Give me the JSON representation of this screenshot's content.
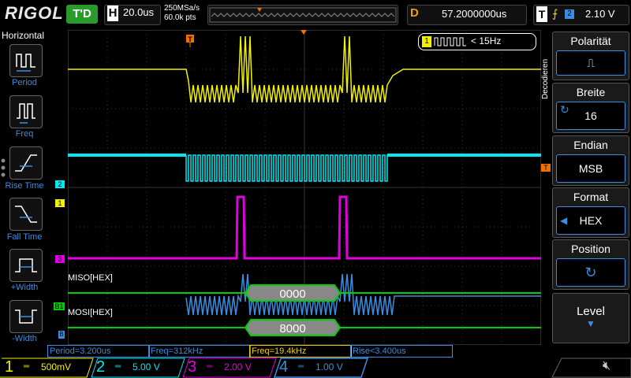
{
  "brand": "RIGOL",
  "top": {
    "trigger_status": "T'D",
    "horiz_label": "H",
    "timebase": "20.0us",
    "sample_rate": "250MSa/s",
    "memory_depth": "60.0k pts",
    "delay_label": "D",
    "delay_value": "57.2000000us",
    "trig_label": "T",
    "trig_source": "2",
    "trig_level": "2.10 V"
  },
  "left_menu": {
    "title": "Horizontal",
    "items": [
      {
        "label": "Period"
      },
      {
        "label": "Freq"
      },
      {
        "label": "Rise Time"
      },
      {
        "label": "Fall Time"
      },
      {
        "label": "+Width"
      },
      {
        "label": "-Width"
      }
    ]
  },
  "right_menu": {
    "tab": "Decodieren",
    "items": [
      {
        "title": "Polarität",
        "value": "⎍"
      },
      {
        "title": "Breite",
        "value": "16"
      },
      {
        "title": "Endian",
        "value": "MSB"
      },
      {
        "title": "Format",
        "value": "HEX"
      },
      {
        "title": "Position",
        "value": "↻"
      },
      {
        "title": "Level",
        "value": ""
      }
    ]
  },
  "counter": {
    "channel": "1",
    "text": "< 15Hz"
  },
  "decode": {
    "miso_label": "MISO[HEX]",
    "miso_value": "0000",
    "mosi_label": "MOSI[HEX]",
    "mosi_value": "8000",
    "bus_marker": "B1"
  },
  "markers": {
    "ch2": "2",
    "ch1": "1",
    "ch3": "3",
    "ch4": "B",
    "trig": "T"
  },
  "measurements": [
    {
      "text": "Period=3.200us",
      "color": "#3a8de0"
    },
    {
      "text": "Freq=312kHz",
      "color": "#3a8de0"
    },
    {
      "text": "Freq=19.4kHz",
      "color": "#f0d000"
    },
    {
      "text": "Rise<3.400us",
      "color": "#3a8de0"
    }
  ],
  "channels": [
    {
      "num": "1",
      "scale": "500mV",
      "color": "#f0f000"
    },
    {
      "num": "2",
      "scale": "5.00 V",
      "color": "#00e8f0"
    },
    {
      "num": "3",
      "scale": "2.00 V",
      "color": "#e000e0"
    },
    {
      "num": "4",
      "scale": "1.00 V",
      "color": "#3a8de0"
    }
  ],
  "colors": {
    "ch1": "#f0f000",
    "ch2": "#00e8f0",
    "ch3": "#e000e0",
    "ch4": "#3a8de0",
    "bus": "#00d000",
    "accent": "#3a8de0"
  }
}
